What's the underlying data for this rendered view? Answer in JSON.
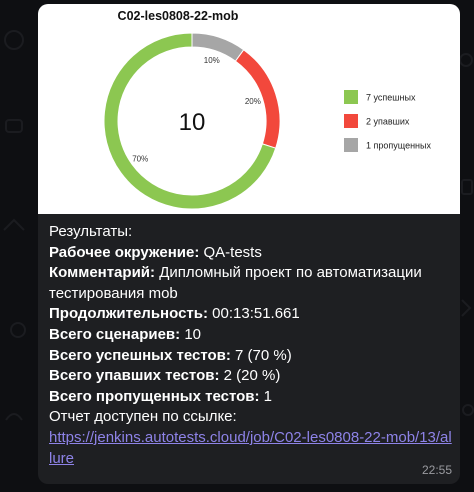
{
  "chart_data": {
    "type": "pie",
    "title": "C02-les0808-22-mob",
    "center_label": "10",
    "categories": [
      "7 успешных",
      "2 упавших",
      "1 пропущенных"
    ],
    "values": [
      7,
      2,
      1
    ],
    "percent_labels": [
      "70%",
      "20%",
      "10%"
    ],
    "colors": [
      "#8cc751",
      "#f2483c",
      "#a6a6a6"
    ],
    "legend": "right"
  },
  "message": {
    "results_label": "Результаты:",
    "env_label": "Рабочее окружение:",
    "env_value": "QA-tests",
    "comment_label": "Комментарий:",
    "comment_value": "Дипломный проект по автоматизации тестирования mob",
    "duration_label": "Продолжительность:",
    "duration_value": "00:13:51.661",
    "scenarios_label": "Всего сценариев:",
    "scenarios_value": "10",
    "passed_label": "Всего успешных тестов:",
    "passed_value": "7 (70 %)",
    "failed_label": "Всего упавших тестов:",
    "failed_value": "2 (20 %)",
    "skipped_label": "Всего пропущенных тестов:",
    "skipped_value": "1",
    "report_label": "Отчет доступен по ссылке:",
    "report_link": "https://jenkins.autotests.cloud/job/C02-les0808-22-mob/13/allure",
    "time": "22:55"
  }
}
